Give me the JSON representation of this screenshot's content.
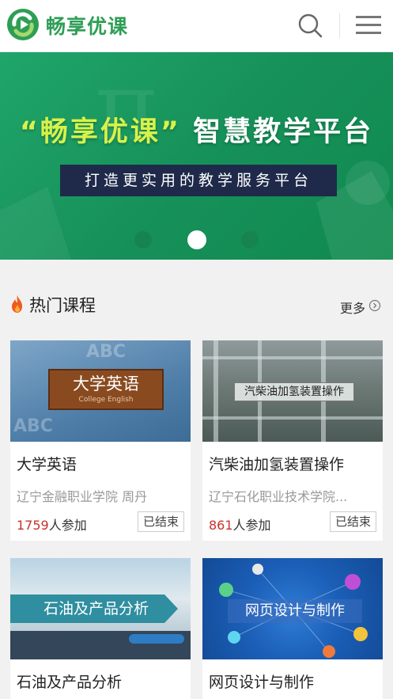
{
  "header": {
    "brand": "畅享优课",
    "logo_icon": "logo-icon",
    "search_icon": "search-icon",
    "menu_icon": "menu-icon"
  },
  "banner": {
    "title_brand": "“畅享优课”",
    "title_rest": " 智慧教学平台",
    "subtitle": "打造更实用的教学服务平台",
    "slide_count": 3,
    "active_slide": 2
  },
  "hot": {
    "title": "热门课程",
    "more_label": "更多",
    "fire_icon": "fire-icon",
    "more_icon": "chevron-circle-right-icon"
  },
  "courses": [
    {
      "name": "大学英语",
      "thumb_title": "大学英语",
      "thumb_subtitle": "College English",
      "meta": "辽宁金融职业学院 周丹",
      "count": "1759",
      "count_suffix": "人参加",
      "status": "已结束"
    },
    {
      "name": "汽柴油加氢装置操作",
      "thumb_title": "汽柴油加氢装置操作",
      "meta": "辽宁石化职业技术学院...",
      "count": "861",
      "count_suffix": "人参加",
      "status": "已结束"
    },
    {
      "name": "石油及产品分析",
      "thumb_title": "石油及产品分析"
    },
    {
      "name": "网页设计与制作",
      "thumb_title": "网页设计与制作"
    }
  ],
  "colors": {
    "brand_green": "#2e9e55",
    "banner_green": "#17915a",
    "count_red": "#c9302c"
  }
}
